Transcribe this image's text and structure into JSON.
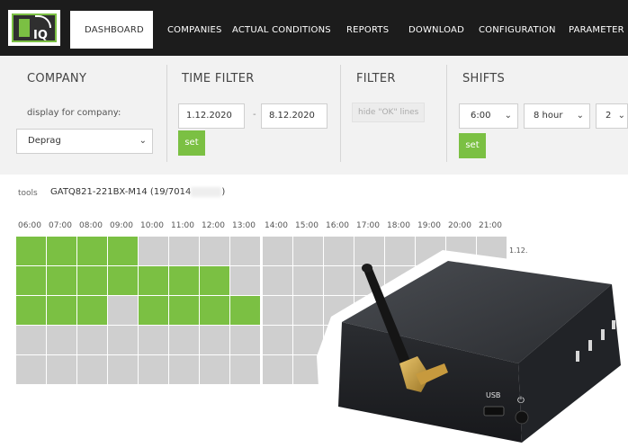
{
  "nav": {
    "logo_text": "IQ",
    "items": [
      {
        "label": "DASHBOARD",
        "active": true
      },
      {
        "label": "COMPANIES",
        "active": false
      },
      {
        "label": "ACTUAL CONDITIONS",
        "active": false
      },
      {
        "label": "REPORTS",
        "active": false
      },
      {
        "label": "DOWNLOAD",
        "active": false
      },
      {
        "label": "CONFIGURATION",
        "active": false
      },
      {
        "label": "PARAMETER",
        "active": false
      }
    ]
  },
  "filters": {
    "company": {
      "title": "COMPANY",
      "label": "display for company:",
      "selected": "Deprag"
    },
    "time_filter": {
      "title": "TIME FILTER",
      "from": "1.12.2020",
      "separator": "-",
      "to": "8.12.2020",
      "set_label": "set"
    },
    "filter": {
      "title": "FILTER",
      "chip": "hide \"OK\" lines"
    },
    "shifts": {
      "title": "SHIFTS",
      "start": "6:00",
      "length": "8 hour",
      "count": "2",
      "set_label": "set"
    }
  },
  "tools": {
    "label": "tools",
    "value": "GATQ821-221BX-M14 (19/7014",
    "value_suffix": ")"
  },
  "timeline": {
    "left_hours": [
      "06:00",
      "07:00",
      "08:00",
      "09:00",
      "10:00",
      "11:00",
      "12:00",
      "13:00"
    ],
    "right_hours": [
      "14:00",
      "15:00",
      "16:00",
      "17:00",
      "18:00",
      "19:00",
      "20:00",
      "21:00"
    ],
    "date_label": "1.12.",
    "colors": {
      "ok": "#7bc043",
      "idle": "#cfcfcf"
    },
    "left_rows": [
      [
        1,
        1,
        1,
        1,
        0,
        0,
        0,
        0
      ],
      [
        1,
        1,
        1,
        1,
        1,
        1,
        1,
        0
      ],
      [
        1,
        1,
        1,
        0,
        1,
        1,
        1,
        1
      ],
      [
        0,
        0,
        0,
        0,
        0,
        0,
        0,
        0
      ],
      [
        0,
        0,
        0,
        0,
        0,
        0,
        0,
        0
      ]
    ]
  },
  "device": {
    "usb_label": "USB",
    "power_icon": "power-icon"
  },
  "accent": "#7bc043"
}
